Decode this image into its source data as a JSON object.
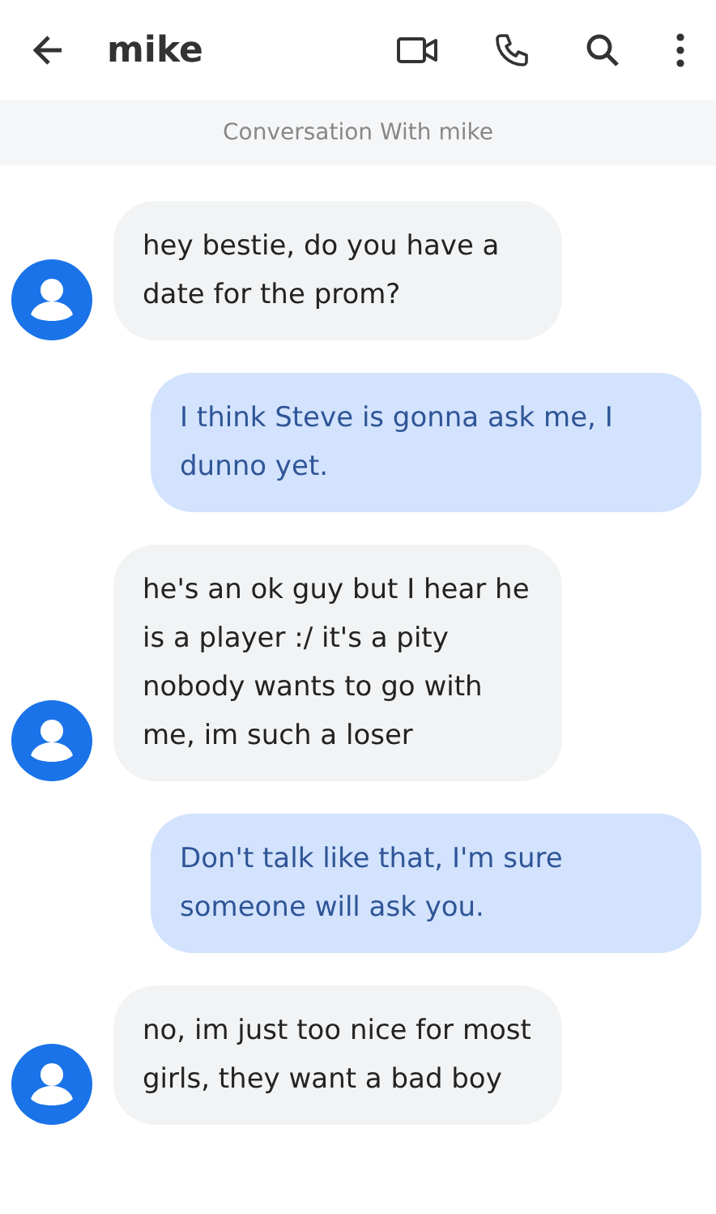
{
  "header": {
    "title": "mike"
  },
  "banner": "Conversation With mike",
  "messages": [
    {
      "kind": "incoming",
      "text": "hey bestie, do you have a date for the prom?"
    },
    {
      "kind": "outgoing",
      "text": "I think Steve is gonna ask me, I dunno yet."
    },
    {
      "kind": "incoming",
      "text": "he's an ok guy but I hear he is a player :/ it's a pity nobody wants to go with me, im such a loser"
    },
    {
      "kind": "outgoing",
      "text": "Don't talk like that, I'm sure someone will ask you."
    },
    {
      "kind": "incoming",
      "text": "no, im just too nice for most girls, they want a bad boy"
    }
  ]
}
